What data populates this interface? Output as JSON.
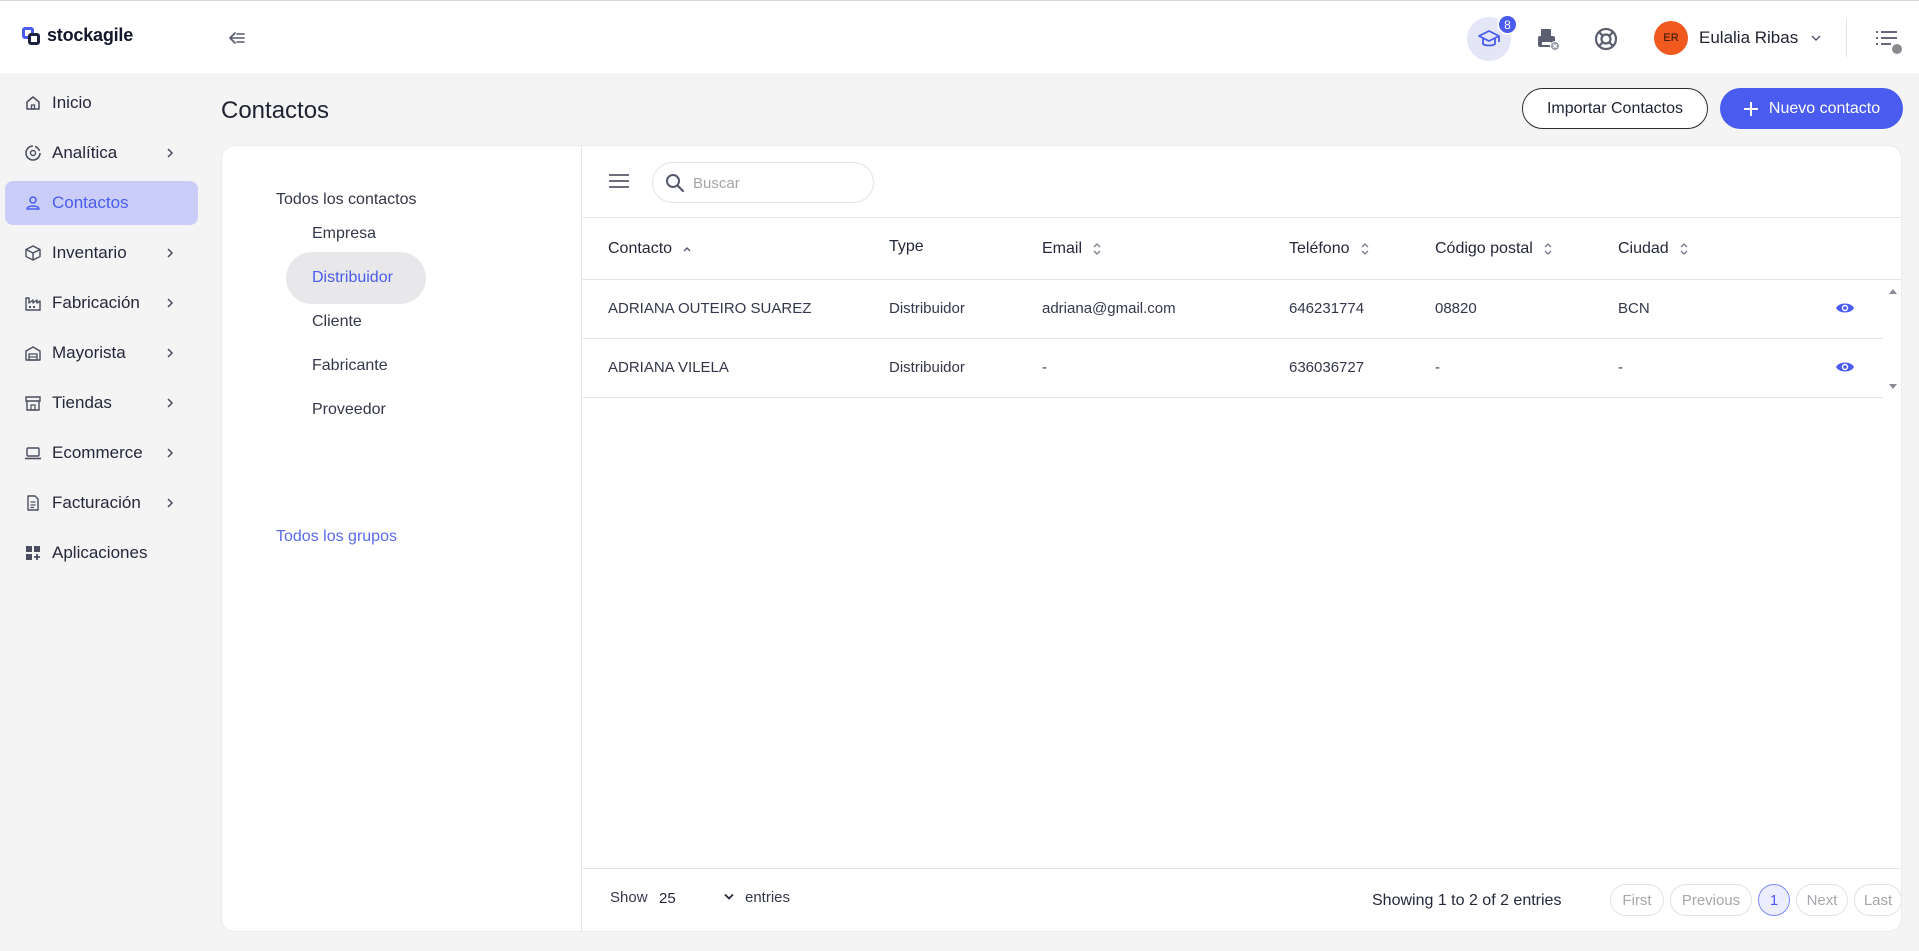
{
  "app": {
    "name": "stockagile"
  },
  "topbar": {
    "learn_badge": "8",
    "user": {
      "initials": "ER",
      "name": "Eulalia Ribas"
    }
  },
  "sidebar": {
    "items": [
      {
        "label": "Inicio",
        "icon": "home-icon"
      },
      {
        "label": "Analítica",
        "icon": "analytics-icon",
        "has_submenu": true
      },
      {
        "label": "Contactos",
        "icon": "user-icon",
        "active": true
      },
      {
        "label": "Inventario",
        "icon": "box-icon",
        "has_submenu": true
      },
      {
        "label": "Fabricación",
        "icon": "factory-icon",
        "has_submenu": true
      },
      {
        "label": "Mayorista",
        "icon": "warehouse-icon",
        "has_submenu": true
      },
      {
        "label": "Tiendas",
        "icon": "store-icon",
        "has_submenu": true
      },
      {
        "label": "Ecommerce",
        "icon": "laptop-icon",
        "has_submenu": true
      },
      {
        "label": "Facturación",
        "icon": "invoice-icon",
        "has_submenu": true
      },
      {
        "label": "Aplicaciones",
        "icon": "apps-icon"
      }
    ]
  },
  "page": {
    "title": "Contactos",
    "import_button": "Importar Contactos",
    "new_button": "Nuevo contacto"
  },
  "groups": {
    "all_contacts": "Todos los contactos",
    "items": [
      {
        "label": "Empresa"
      },
      {
        "label": "Distribuidor",
        "active": true
      },
      {
        "label": "Cliente"
      },
      {
        "label": "Fabricante"
      },
      {
        "label": "Proveedor"
      }
    ],
    "all_groups": "Todos los grupos"
  },
  "search": {
    "placeholder": "Buscar"
  },
  "table": {
    "columns": [
      "Contacto",
      "Type",
      "Email",
      "Teléfono",
      "Código postal",
      "Ciudad"
    ],
    "sort": {
      "column": "Contacto",
      "direction": "asc"
    },
    "rows": [
      {
        "contacto": "ADRIANA OUTEIRO SUAREZ",
        "type": "Distribuidor",
        "email": "adriana@gmail.com",
        "telefono": "646231774",
        "codigo_postal": "08820",
        "ciudad": "BCN"
      },
      {
        "contacto": "ADRIANA VILELA",
        "type": "Distribuidor",
        "email": "-",
        "telefono": "636036727",
        "codigo_postal": "-",
        "ciudad": "-"
      }
    ]
  },
  "footer": {
    "show_label": "Show",
    "page_size": "25",
    "entries_label": "entries",
    "summary": "Showing 1 to 2 of 2 entries",
    "pagination": {
      "first": "First",
      "previous": "Previous",
      "current": "1",
      "next": "Next",
      "last": "Last"
    }
  },
  "colors": {
    "accent": "#4a5cf0",
    "active_nav_bg": "#c9cdf8",
    "avatar_bg": "#f05a1e"
  }
}
